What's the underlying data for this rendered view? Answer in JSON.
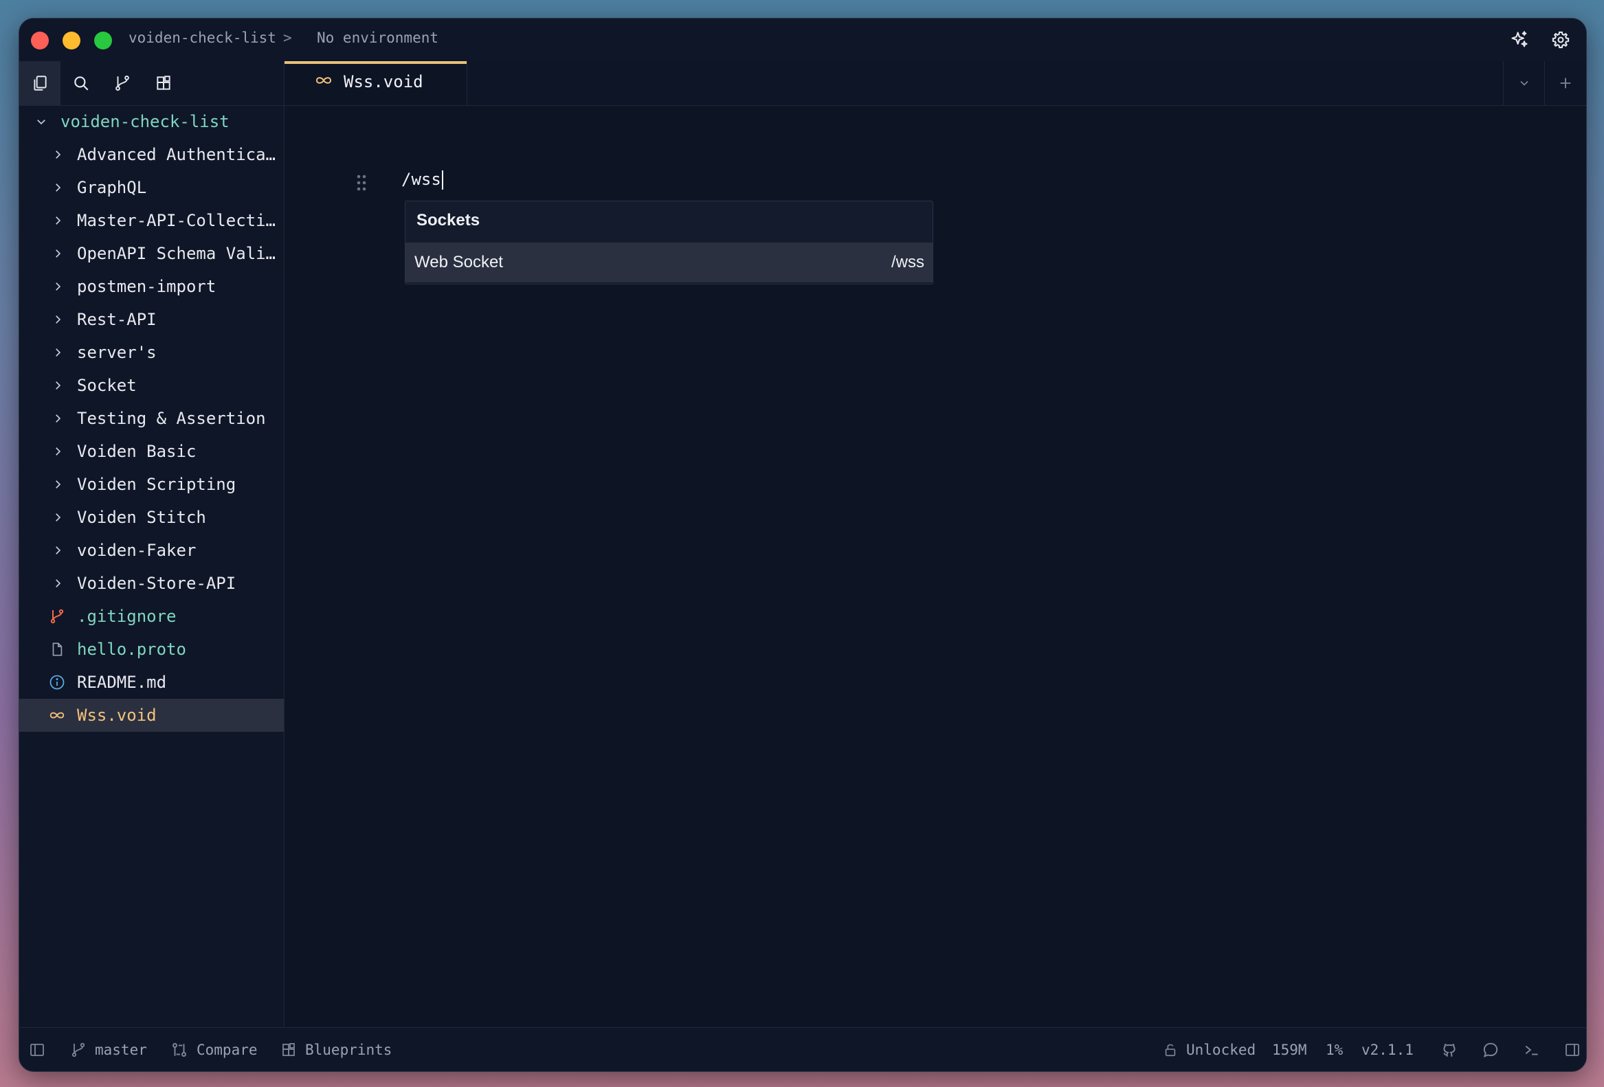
{
  "titlebar": {
    "project": "voiden-check-list",
    "separator": ">",
    "environment": "No environment"
  },
  "sidebar": {
    "root_label": "voiden-check-list",
    "folders": [
      "Advanced Authenticat…",
      "GraphQL",
      "Master-API-Collection",
      "OpenAPI Schema Valid…",
      "postmen-import",
      "Rest-API",
      "server's",
      "Socket",
      "Testing & Assertion",
      "Voiden Basic",
      "Voiden Scripting",
      "Voiden Stitch",
      "voiden-Faker",
      "Voiden-Store-API"
    ],
    "files": [
      {
        "label": ".gitignore",
        "icon": "git-branch-icon"
      },
      {
        "label": "hello.proto",
        "icon": "file-icon"
      },
      {
        "label": "README.md",
        "icon": "info-icon"
      },
      {
        "label": "Wss.void",
        "icon": "infinity-icon"
      }
    ]
  },
  "tabs": [
    {
      "label": "Wss.void",
      "icon": "infinity-icon"
    }
  ],
  "editor": {
    "line_text": "/wss"
  },
  "slash_menu": {
    "group": "Sockets",
    "items": [
      {
        "label": "Web Socket",
        "command": "/wss"
      }
    ]
  },
  "statusbar": {
    "branch": "master",
    "compare": "Compare",
    "blueprints": "Blueprints",
    "lock_status": "Unlocked",
    "memory": "159M",
    "cpu": "1%",
    "version": "v2.1.1"
  },
  "colors": {
    "background": "#0d1424",
    "accent_tab": "#e9c17a",
    "tree_root_text": "#7fd6c2",
    "gitignore_icon": "#f06a4a",
    "info_icon": "#5aa9e6"
  }
}
